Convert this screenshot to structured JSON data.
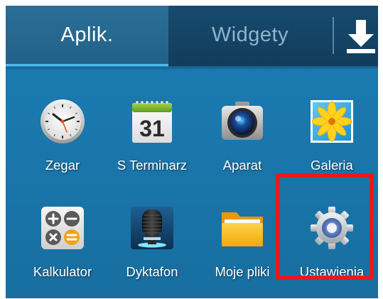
{
  "tabs": {
    "apps_label": "Aplik.",
    "widgets_label": "Widgety",
    "download_icon": "download-icon"
  },
  "apps": [
    {
      "label": "Zegar",
      "icon": "clock-icon"
    },
    {
      "label": "S Terminarz",
      "icon": "calendar-icon",
      "calendar_day": "31"
    },
    {
      "label": "Aparat",
      "icon": "camera-icon"
    },
    {
      "label": "Galeria",
      "icon": "gallery-icon"
    },
    {
      "label": "Kalkulator",
      "icon": "calculator-icon"
    },
    {
      "label": "Dyktafon",
      "icon": "microphone-icon"
    },
    {
      "label": "Moje pliki",
      "icon": "folder-icon"
    },
    {
      "label": "Ustawienia",
      "icon": "settings-gear-icon"
    }
  ],
  "colors": {
    "accent": "#4fb7ef",
    "highlight": "#e8191e",
    "background": "#1a78ad"
  }
}
